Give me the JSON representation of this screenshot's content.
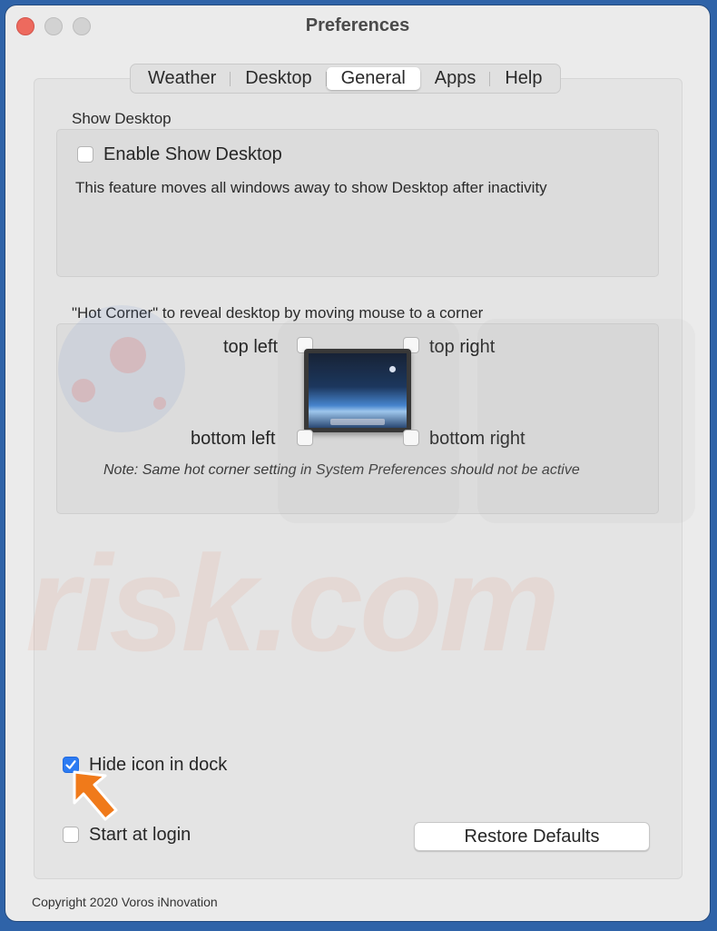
{
  "window": {
    "title": "Preferences"
  },
  "tabs": [
    {
      "label": "Weather",
      "active": false
    },
    {
      "label": "Desktop",
      "active": false
    },
    {
      "label": "General",
      "active": true
    },
    {
      "label": "Apps",
      "active": false
    },
    {
      "label": "Help",
      "active": false
    }
  ],
  "show_desktop": {
    "section_label": "Show Desktop",
    "checkbox_label": "Enable Show Desktop",
    "checked": false,
    "description": "This feature moves all windows away to show Desktop after inactivity"
  },
  "hot_corner": {
    "section_label": "\"Hot Corner\" to reveal desktop by moving mouse to a corner",
    "top_left": "top left",
    "top_right": "top right",
    "bottom_left": "bottom left",
    "bottom_right": "bottom right",
    "note": "Note: Same hot corner setting in System Preferences should not be active"
  },
  "options": {
    "hide_icon_label": "Hide icon in dock",
    "hide_icon_checked": true,
    "start_at_login_label": "Start at login",
    "start_at_login_checked": false
  },
  "buttons": {
    "restore_defaults": "Restore Defaults"
  },
  "footer": {
    "copyright": "Copyright 2020 Voros iNnovation"
  },
  "watermark": {
    "text": "risk.com"
  },
  "colors": {
    "accent": "#2c7bf2",
    "close": "#ed6a5e",
    "arrow": "#f07a1a",
    "background": "#2f63a8"
  }
}
